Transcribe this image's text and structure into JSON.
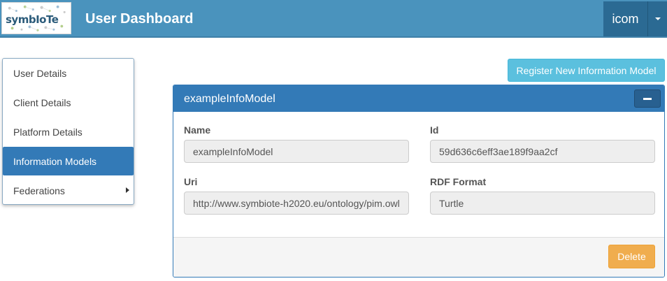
{
  "navbar": {
    "logo_text": "symbIoTe",
    "brand": "User Dashboard",
    "user": "icom",
    "colors": {
      "bar": "#4a93bd",
      "user_button": "#2b6a93"
    }
  },
  "sidebar": {
    "items": [
      {
        "label": "User Details"
      },
      {
        "label": "Client Details"
      },
      {
        "label": "Platform Details"
      },
      {
        "label": "Information Models",
        "active": true
      },
      {
        "label": "Federations",
        "has_submenu": true
      }
    ],
    "active_color": "#337ab7"
  },
  "actions": {
    "register_label": "Register New Information Model",
    "register_color": "#5bc0de"
  },
  "panel": {
    "title": "exampleInfoModel",
    "collapse_icon": "minus-icon",
    "fields": {
      "name": {
        "label": "Name",
        "value": "exampleInfoModel"
      },
      "id": {
        "label": "Id",
        "value": "59d636c6eff3ae189f9aa2cf"
      },
      "uri": {
        "label": "Uri",
        "value": "http://www.symbiote-h2020.eu/ontology/pim.owl"
      },
      "rdf_format": {
        "label": "RDF Format",
        "value": "Turtle"
      }
    },
    "delete_label": "Delete",
    "delete_color": "#f0ad4e"
  }
}
